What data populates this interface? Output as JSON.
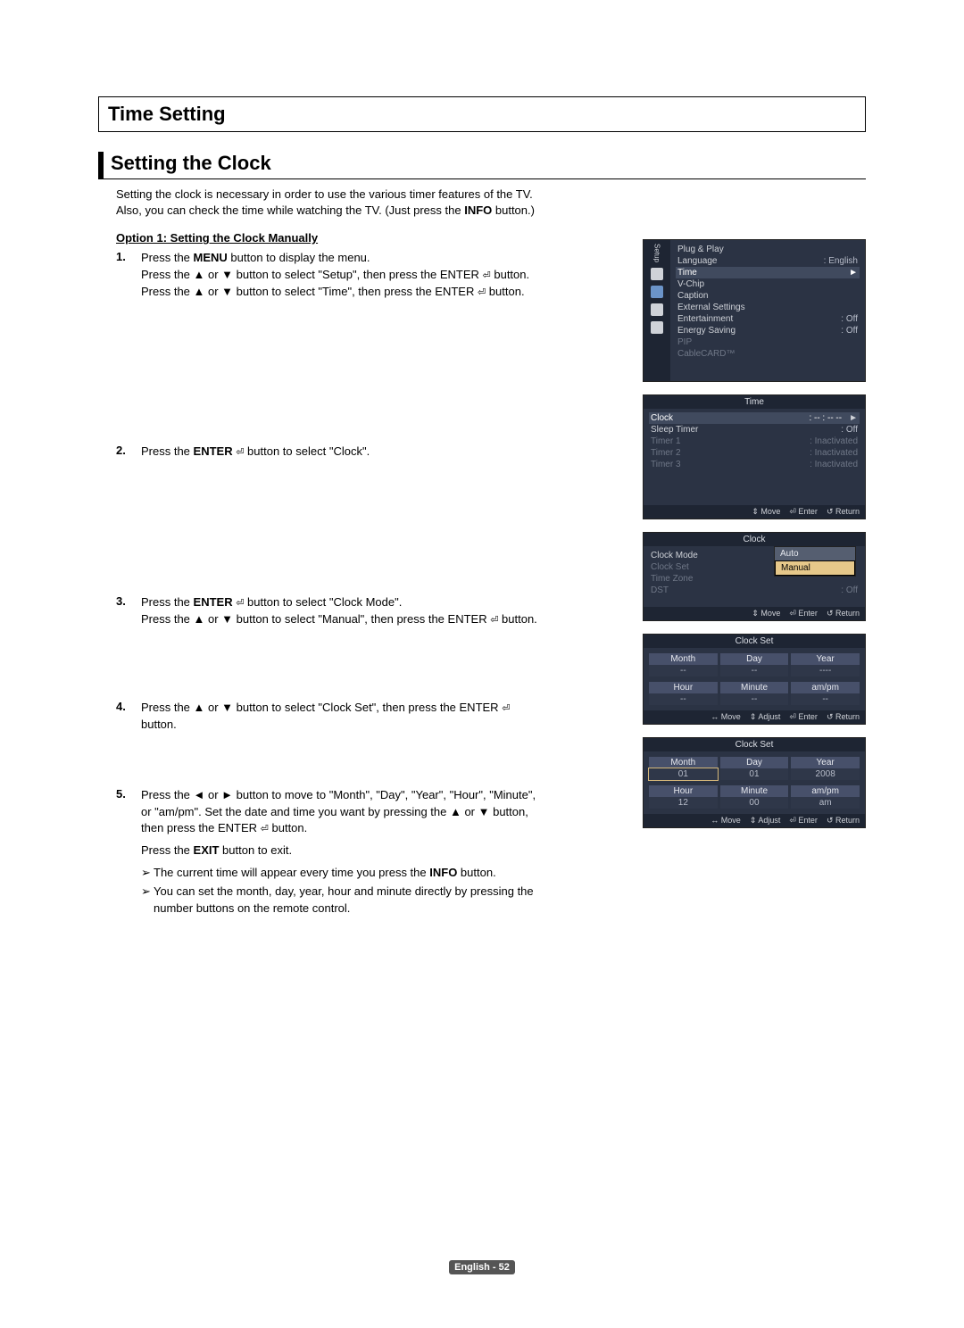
{
  "title": "Time Setting",
  "subtitle": "Setting the Clock",
  "intro_line1": "Setting the clock is necessary in order to use the various timer features of the TV.",
  "intro_line2": "Also, you can check the time while watching the TV. (Just press the INFO button.)",
  "option_header": "Option 1: Setting the Clock Manually",
  "steps": {
    "s1": {
      "num": "1.",
      "l1a": "Press the ",
      "l1b": "MENU",
      "l1c": " button to display the menu.",
      "l2": "Press the ▲ or ▼ button to select \"Setup\", then press the ENTER ",
      "l2b": " button.",
      "l3": "Press the ▲ or ▼ button to select \"Time\", then press the ENTER ",
      "l3b": " button."
    },
    "s2": {
      "num": "2.",
      "l1": "Press the ENTER ",
      "l1b": " button to select \"Clock\"."
    },
    "s3": {
      "num": "3.",
      "l1": "Press the ENTER ",
      "l1b": " button to select \"Clock Mode\".",
      "l2": "Press the ▲ or ▼ button to select \"Manual\", then press the ENTER ",
      "l2b": " button."
    },
    "s4": {
      "num": "4.",
      "l1": "Press the ▲ or ▼ button to select \"Clock Set\", then press the ENTER ",
      "l1b": " button."
    },
    "s5": {
      "num": "5.",
      "l1": "Press the ◄ or ► button to move to \"Month\", \"Day\", \"Year\", \"Hour\", \"Minute\", or \"am/pm\". Set the date and time you want by pressing the ▲ or ▼ button, then press the ENTER ",
      "l1b": " button.",
      "l2a": "Press the ",
      "l2b": "EXIT",
      "l2c": " button to exit.",
      "a1a": "The current time will appear every time you press the ",
      "a1b": "INFO",
      "a1c": " button.",
      "a2": "You can set the month, day, year, hour and minute directly by pressing the number buttons on the remote control."
    }
  },
  "setup_menu": {
    "side_label": "Setup",
    "items": [
      {
        "k": "Plug & Play",
        "v": ""
      },
      {
        "k": "Language",
        "v": ": English"
      },
      {
        "k": "Time",
        "v": "►",
        "hl": true
      },
      {
        "k": "V-Chip",
        "v": ""
      },
      {
        "k": "Caption",
        "v": ""
      },
      {
        "k": "External Settings",
        "v": ""
      },
      {
        "k": "Entertainment",
        "v": ": Off"
      },
      {
        "k": "Energy Saving",
        "v": ": Off"
      },
      {
        "k": "PIP",
        "v": "",
        "dim": true
      },
      {
        "k": "CableCARD™",
        "v": "",
        "dim": true
      }
    ]
  },
  "time_menu": {
    "header": "Time",
    "items": [
      {
        "k": "Clock",
        "v": ": -- : -- --",
        "hl": true,
        "arrow": "►"
      },
      {
        "k": "Sleep Timer",
        "v": ": Off"
      },
      {
        "k": "Timer 1",
        "v": ": Inactivated",
        "dim": true
      },
      {
        "k": "Timer 2",
        "v": ": Inactivated",
        "dim": true
      },
      {
        "k": "Timer 3",
        "v": ": Inactivated",
        "dim": true
      }
    ],
    "footer": [
      "⇕ Move",
      "⏎ Enter",
      "↺ Return"
    ]
  },
  "clock_menu": {
    "header": "Clock",
    "items": [
      {
        "k": "Clock Mode",
        "v": ""
      },
      {
        "k": "Clock Set",
        "v": "",
        "dim": true
      },
      {
        "k": "Time Zone",
        "v": "",
        "dim": true
      },
      {
        "k": "DST",
        "v": ": Off",
        "dim": true
      }
    ],
    "popup": {
      "opts": [
        "Auto",
        "Manual"
      ],
      "sel": "Manual"
    },
    "footer": [
      "⇕ Move",
      "⏎ Enter",
      "↺ Return"
    ]
  },
  "clockset1": {
    "header": "Clock Set",
    "labels_top": [
      "Month",
      "Day",
      "Year"
    ],
    "vals_top": [
      "--",
      "--",
      "----"
    ],
    "labels_bot": [
      "Hour",
      "Minute",
      "am/pm"
    ],
    "vals_bot": [
      "--",
      "--",
      "--"
    ],
    "footer": [
      "↔ Move",
      "⇕ Adjust",
      "⏎ Enter",
      "↺ Return"
    ]
  },
  "clockset2": {
    "header": "Clock Set",
    "labels_top": [
      "Month",
      "Day",
      "Year"
    ],
    "vals_top": [
      "01",
      "01",
      "2008"
    ],
    "labels_bot": [
      "Hour",
      "Minute",
      "am/pm"
    ],
    "vals_bot": [
      "12",
      "00",
      "am"
    ],
    "footer": [
      "↔ Move",
      "⇕ Adjust",
      "⏎ Enter",
      "↺ Return"
    ]
  },
  "footer_page": "English - 52",
  "enter_glyph": "⏎",
  "bullet": "➢"
}
